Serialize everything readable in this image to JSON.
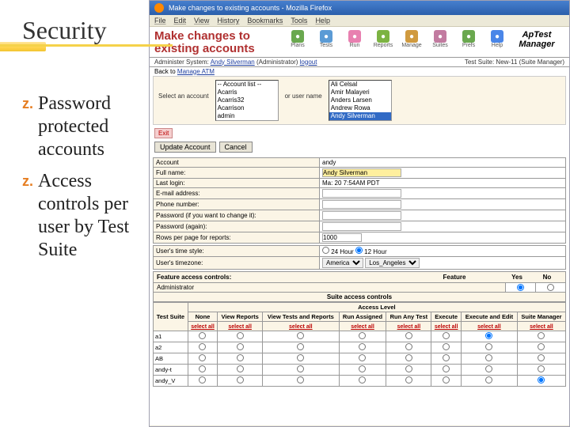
{
  "slide": {
    "title": "Security",
    "bullets": [
      "Password protected accounts",
      "Access controls per user by Test Suite"
    ]
  },
  "browser": {
    "windowTitle": "Make changes to existing accounts - Mozilla Firefox",
    "menubar": [
      "File",
      "Edit",
      "View",
      "History",
      "Bookmarks",
      "Tools",
      "Help"
    ]
  },
  "header": {
    "title": "Make changes to existing accounts",
    "navIcons": [
      {
        "name": "plans",
        "label": "Plans",
        "color": "#6aa84f"
      },
      {
        "name": "tests",
        "label": "Tests",
        "color": "#5b9bd5"
      },
      {
        "name": "run",
        "label": "Run",
        "color": "#e880b0"
      },
      {
        "name": "reports",
        "label": "Reports",
        "color": "#7cb342"
      },
      {
        "name": "manage",
        "label": "Manage",
        "color": "#d09a3f"
      },
      {
        "name": "suites",
        "label": "Suites",
        "color": "#c27ba0"
      },
      {
        "name": "prefs",
        "label": "Prefs",
        "color": "#6aa84f"
      },
      {
        "name": "help",
        "label": "Help",
        "color": "#4a86e8"
      }
    ],
    "logo1": "ApTest",
    "logo2": "Manager"
  },
  "adminLine": {
    "prefix": "Administer System:",
    "user": "Andy Silverman",
    "role": "(Administrator)",
    "logout": "logout",
    "right": "Test Suite: New-11 (Suite Manager)"
  },
  "backLink": {
    "back": "Back to",
    "target": "Manage ATM"
  },
  "select": {
    "label1": "Select an account",
    "listHeader": "-- Account list --",
    "accounts": [
      "Acarris",
      "Acarris32",
      "Acarrison",
      "admin"
    ],
    "label2": "or user name",
    "names": [
      "Ali Celsal",
      "Amir Malayeri",
      "Anders Larsen",
      "Andrew Rowa",
      "Andy Silverman"
    ],
    "namesSelected": 4
  },
  "buttons": {
    "exit": "Exit",
    "update": "Update Account",
    "cancel": "Cancel"
  },
  "form": {
    "rows": [
      {
        "label": "Account",
        "value": "andy",
        "type": "text-plain"
      },
      {
        "label": "Full name:",
        "value": "Andy Silverman",
        "type": "input-yellow"
      },
      {
        "label": "Last login:",
        "value": "Ma: 20 7:54AM PDT",
        "type": "text-plain"
      },
      {
        "label": "E-mail address:",
        "value": "",
        "type": "input"
      },
      {
        "label": "Phone number:",
        "value": "",
        "type": "input"
      },
      {
        "label": "Password (if you want to change it):",
        "value": "",
        "type": "password"
      },
      {
        "label": "Password (again):",
        "value": "",
        "type": "password"
      },
      {
        "label": "Rows per page for reports:",
        "value": "1000",
        "type": "input-short"
      }
    ],
    "timeStyleLabel": "User's time style:",
    "time24": "24 Hour",
    "time12": "12 Hour",
    "time12Selected": true,
    "tzLabel": "User's timezone:",
    "tzRegion": "America",
    "tzCity": "Los_Angeles"
  },
  "features": {
    "header": "Feature access controls:",
    "featureCol": "Feature",
    "yes": "Yes",
    "no": "No",
    "row": "Administrator",
    "selected": "yes"
  },
  "suite": {
    "header": "Suite access controls",
    "tsHeader": "Test Suite",
    "alHeader": "Access Level",
    "cols": [
      "None",
      "View Reports",
      "View Tests and Reports",
      "Run Assigned",
      "Run Any Test",
      "Execute",
      "Execute and Edit",
      "Suite Manager"
    ],
    "selectAll": "select all",
    "rows": [
      "a1",
      "a2",
      "AB",
      "andy-t",
      "andy_V"
    ],
    "checked": {
      "0": 6,
      "4": 7
    }
  }
}
